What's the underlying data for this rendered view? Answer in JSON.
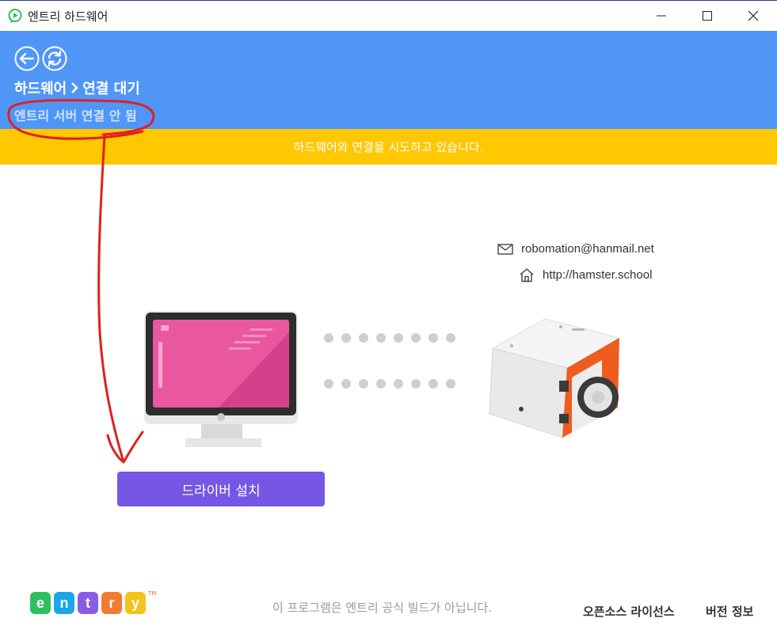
{
  "window": {
    "title": "엔트리 하드웨어"
  },
  "header": {
    "breadcrumb_root": "하드웨어",
    "breadcrumb_current": "연결 대기",
    "server_status": "엔트리 서버 연결 안 됨"
  },
  "notice": {
    "text": "하드웨어와 연결을 시도하고 있습니다."
  },
  "contacts": {
    "email": "robomation@hanmail.net",
    "website": "http://hamster.school"
  },
  "actions": {
    "install_driver": "드라이버 설치"
  },
  "footer": {
    "logo_letters": [
      "e",
      "n",
      "t",
      "r",
      "y"
    ],
    "logo_tm": "TM",
    "note": "이 프로그램은 엔트리 공식 빌드가 아닙니다.",
    "open_source_license": "오픈소스 라이선스",
    "version_info": "버전 정보"
  },
  "colors": {
    "header_bg": "#4f96f7",
    "notice_bg": "#ffc800",
    "button_bg": "#7557e3",
    "logo": [
      "#2ec05f",
      "#1aa7e8",
      "#8a5ce6",
      "#f27b33",
      "#f5c21a"
    ]
  }
}
